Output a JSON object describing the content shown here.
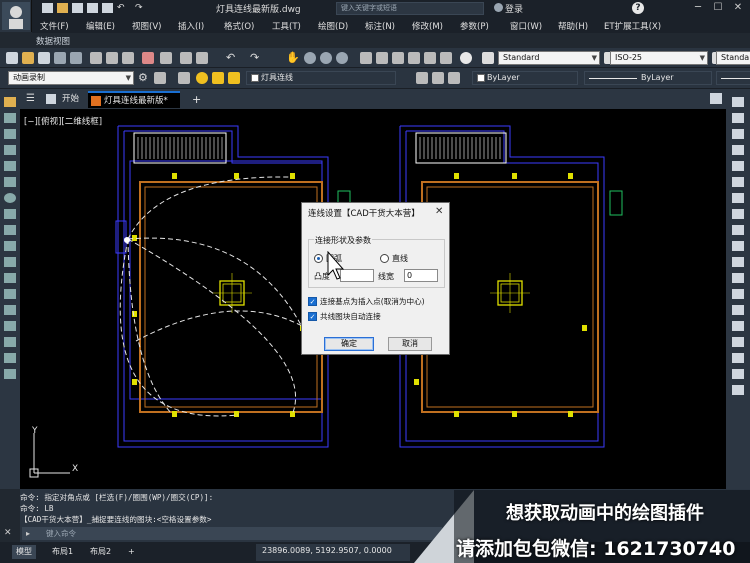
{
  "window": {
    "title": "灯具连线最新版.dwg",
    "search_placeholder": "键入关键字或短语",
    "login_label": "登录",
    "minimize": "─",
    "maximize": "☐",
    "close": "✕",
    "help": "?"
  },
  "menu": [
    "文件(F)",
    "编辑(E)",
    "视图(V)",
    "插入(I)",
    "格式(O)",
    "工具(T)",
    "绘图(D)",
    "标注(N)",
    "修改(M)",
    "参数(P)",
    "窗口(W)",
    "帮助(H)",
    "ET扩展工具(X)"
  ],
  "subtitle": "数据视图",
  "toolbar": {
    "text_style": "Standard",
    "dim_style": "ISO-25",
    "table_style": "Standa",
    "workspace": "动画录制",
    "layer": "灯具连线",
    "color": "ByLayer",
    "linetype": "ByLayer"
  },
  "tabs": {
    "start": "开始",
    "document": "灯具连线最新版*",
    "add": "+"
  },
  "view_label": "[−][俯视][二维线框]",
  "dialog": {
    "title": "连线设置【CAD干货大本营】",
    "close": "✕",
    "group_label": "连接形状及参数",
    "radio_arc": "圆弧",
    "radio_line": "直线",
    "bulge_label": "凸度",
    "bulge_value": "",
    "linewidth_label": "线宽",
    "linewidth_value": "0",
    "check1": "连接基点为插入点(取消为中心)",
    "check2": "共线图块自动连接",
    "ok": "确定",
    "cancel": "取消"
  },
  "command": {
    "line1": "命令: 指定对角点或 [栏选(F)/圈围(WP)/圈交(CP)]:",
    "line2": "命令: LB",
    "line3": "【CAD干货大本营】_捕捉要连线的图块:<空格设置参数>",
    "input_placeholder": "键入命令"
  },
  "status": {
    "model": "模型",
    "layout1": "布局1",
    "layout2": "布局2",
    "add": "+",
    "coords": "23896.0089, 5192.9507, 0.0000"
  },
  "overlay": {
    "line1": "想获取动画中的绘图插件",
    "line2": "请添加包包微信: 1621730740"
  },
  "colors": {
    "accent": "#1a6fd1",
    "wall": "#3b3bff",
    "room_outline": "#c07020",
    "lamp": "#e0e000"
  }
}
